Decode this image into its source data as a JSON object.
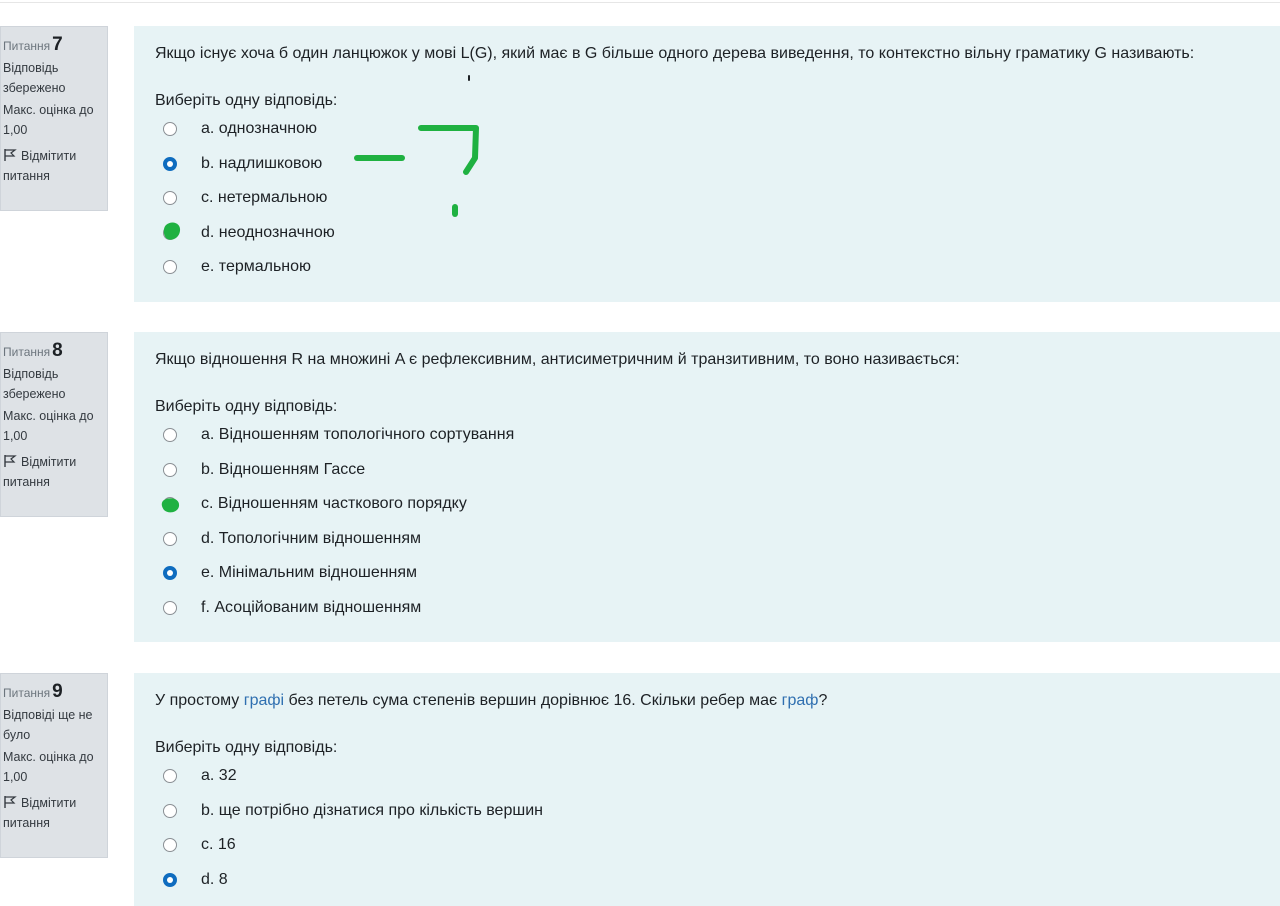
{
  "questions": [
    {
      "label": "Питання",
      "number": "7",
      "state": "Відповідь збережено",
      "grade": "Макс. оцінка до 1,00",
      "flag": "Відмітити питання",
      "text": "Якщо існує хоча б один ланцюжок у мові L(G), який має в G більше одного дерева виведення, то контекстно вільну граматику G називають:",
      "prompt": "Виберіть одну відповідь:",
      "answers": [
        {
          "label": "a. однозначною",
          "checked": false
        },
        {
          "label": "b. надлишковою",
          "checked": true
        },
        {
          "label": "c. нетермальною",
          "checked": false
        },
        {
          "label": "d. неоднозначною",
          "checked": false
        },
        {
          "label": "e. термальною",
          "checked": false
        }
      ]
    },
    {
      "label": "Питання",
      "number": "8",
      "state": "Відповідь збережено",
      "grade": "Макс. оцінка до 1,00",
      "flag": "Відмітити питання",
      "text": "Якщо відношення R на множині A є рефлексивним, антисиметричним й транзитивним, то воно називається:",
      "prompt": "Виберіть одну відповідь:",
      "answers": [
        {
          "label": "a. Відношенням топологічного сортування",
          "checked": false
        },
        {
          "label": "b. Відношенням Гассе",
          "checked": false
        },
        {
          "label": "c. Відношенням часткового порядку",
          "checked": false
        },
        {
          "label": "d. Топологічним відношенням",
          "checked": false
        },
        {
          "label": "e. Мінімальним відношенням",
          "checked": true
        },
        {
          "label": "f. Асоційованим відношенням",
          "checked": false
        }
      ]
    },
    {
      "label": "Питання",
      "number": "9",
      "state": "Відповіді ще не було",
      "grade": "Макс. оцінка до 1,00",
      "flag": "Відмітити питання",
      "text_parts": [
        "У простому ",
        "графі",
        " без петель сума степенів вершин дорівнює 16. Скільки ребер має ",
        "граф",
        "?"
      ],
      "prompt": "Виберіть одну відповідь:",
      "answers": [
        {
          "label": "a. 32",
          "checked": false
        },
        {
          "label": "b. ще потрібно дізнатися про кількість вершин",
          "checked": false
        },
        {
          "label": "c. 16",
          "checked": false
        },
        {
          "label": "d. 8",
          "checked": true
        }
      ]
    }
  ],
  "colors": {
    "info_bg": "#dee2e6",
    "content_bg": "#e7f3f5",
    "radio_checked": "#0f6cbf",
    "link": "#2f6fb0",
    "annotation_green": "#1fb141"
  }
}
